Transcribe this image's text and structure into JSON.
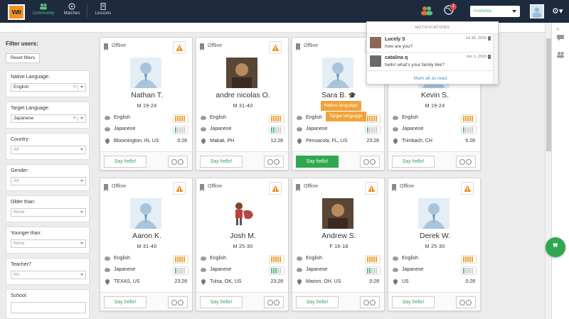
{
  "app": {
    "logo_text": "we",
    "nav": [
      {
        "label": "Community",
        "icon": "community-icon",
        "active": true
      },
      {
        "label": "Matches",
        "icon": "matches-icon",
        "active": false
      },
      {
        "label": "Lessons",
        "icon": "lessons-icon",
        "active": false
      }
    ],
    "notification_count": "1",
    "status": "Available",
    "accent_color": "#2fa84f",
    "native_color": "#f0a33a"
  },
  "notifications": {
    "header": "NOTIFICATIONS",
    "items": [
      {
        "name": "Lucely S",
        "date": "Jul 30, 2015",
        "message": "how are you?"
      },
      {
        "name": "catalina q",
        "date": "Jun 1, 2015",
        "message": "hello! what's your family like?"
      }
    ],
    "mark_all": "Mark all as read"
  },
  "filters": {
    "title": "Filter users:",
    "reset": "Reset filters",
    "native": {
      "label": "Native Language:",
      "value": "English"
    },
    "target": {
      "label": "Target Language:",
      "value": "Japanese"
    },
    "country": {
      "label": "Country:",
      "value": "All"
    },
    "gender": {
      "label": "Gender:",
      "value": "All"
    },
    "older": {
      "label": "Older than:",
      "value": "None"
    },
    "younger": {
      "label": "Younger than:",
      "value": "None"
    },
    "teacher": {
      "label": "Teacher?",
      "value": "No"
    },
    "school": {
      "label": "School:"
    }
  },
  "cards": [
    {
      "status": "Offline",
      "name": "Nathan T.",
      "info": "M 19-24",
      "native": "English",
      "target": "Japanese",
      "target_level": 1,
      "location": "Bloomington, IN, US",
      "time": "0:28",
      "say": "Say hello!",
      "photo": "default-avatar"
    },
    {
      "status": "Offline",
      "name": "andre nicolas O.",
      "info": "M 31-40",
      "native": "English",
      "target": "Japanese",
      "target_level": 2,
      "location": "Makati, PH",
      "time": "12:28",
      "say": "Say hello!",
      "photo": "user-photo"
    },
    {
      "status": "Offline",
      "name": "Sara B.",
      "info": "",
      "native": "English",
      "target": "Japanese",
      "target_level": 1,
      "location": "Pensacola, FL, US",
      "time": "23:28",
      "say": "Say hello!",
      "photo": "default-avatar"
    },
    {
      "status": "",
      "name": "Kevin S.",
      "info": "M 19-24",
      "native": "English",
      "target": "Japanese",
      "target_level": 1,
      "location": "Trimbach, CH",
      "time": "6:28",
      "say": "Say hello!",
      "photo": "default-avatar"
    },
    {
      "status": "Offline",
      "name": "Aaron K.",
      "info": "M 31-40",
      "native": "English",
      "target": "Japanese",
      "target_level": 1,
      "location": "TEXAS, US",
      "time": "23:28",
      "say": "Say hello!",
      "photo": "default-avatar"
    },
    {
      "status": "Offline",
      "name": "Josh M.",
      "info": "M 25-30",
      "native": "English",
      "target": "Japanese",
      "target_level": 3,
      "location": "Tulsa, OK, US",
      "time": "23:28",
      "say": "Say hello!",
      "photo": "cartoon-photo"
    },
    {
      "status": "Offline",
      "name": "Andrew S.",
      "info": "F 16-18",
      "native": "English",
      "target": "Japanese",
      "target_level": 2,
      "location": "Marion, OH, US",
      "time": "0:28",
      "say": "Say hello!",
      "photo": "user-photo"
    },
    {
      "status": "Offline",
      "name": "Derek W.",
      "info": "M 25-30",
      "native": "English",
      "target": "Japanese",
      "target_level": 1,
      "location": "US",
      "time": "0:28",
      "say": "Say hello!",
      "photo": "default-avatar"
    }
  ],
  "tooltips": {
    "native": "Native language",
    "target": "Target language"
  }
}
